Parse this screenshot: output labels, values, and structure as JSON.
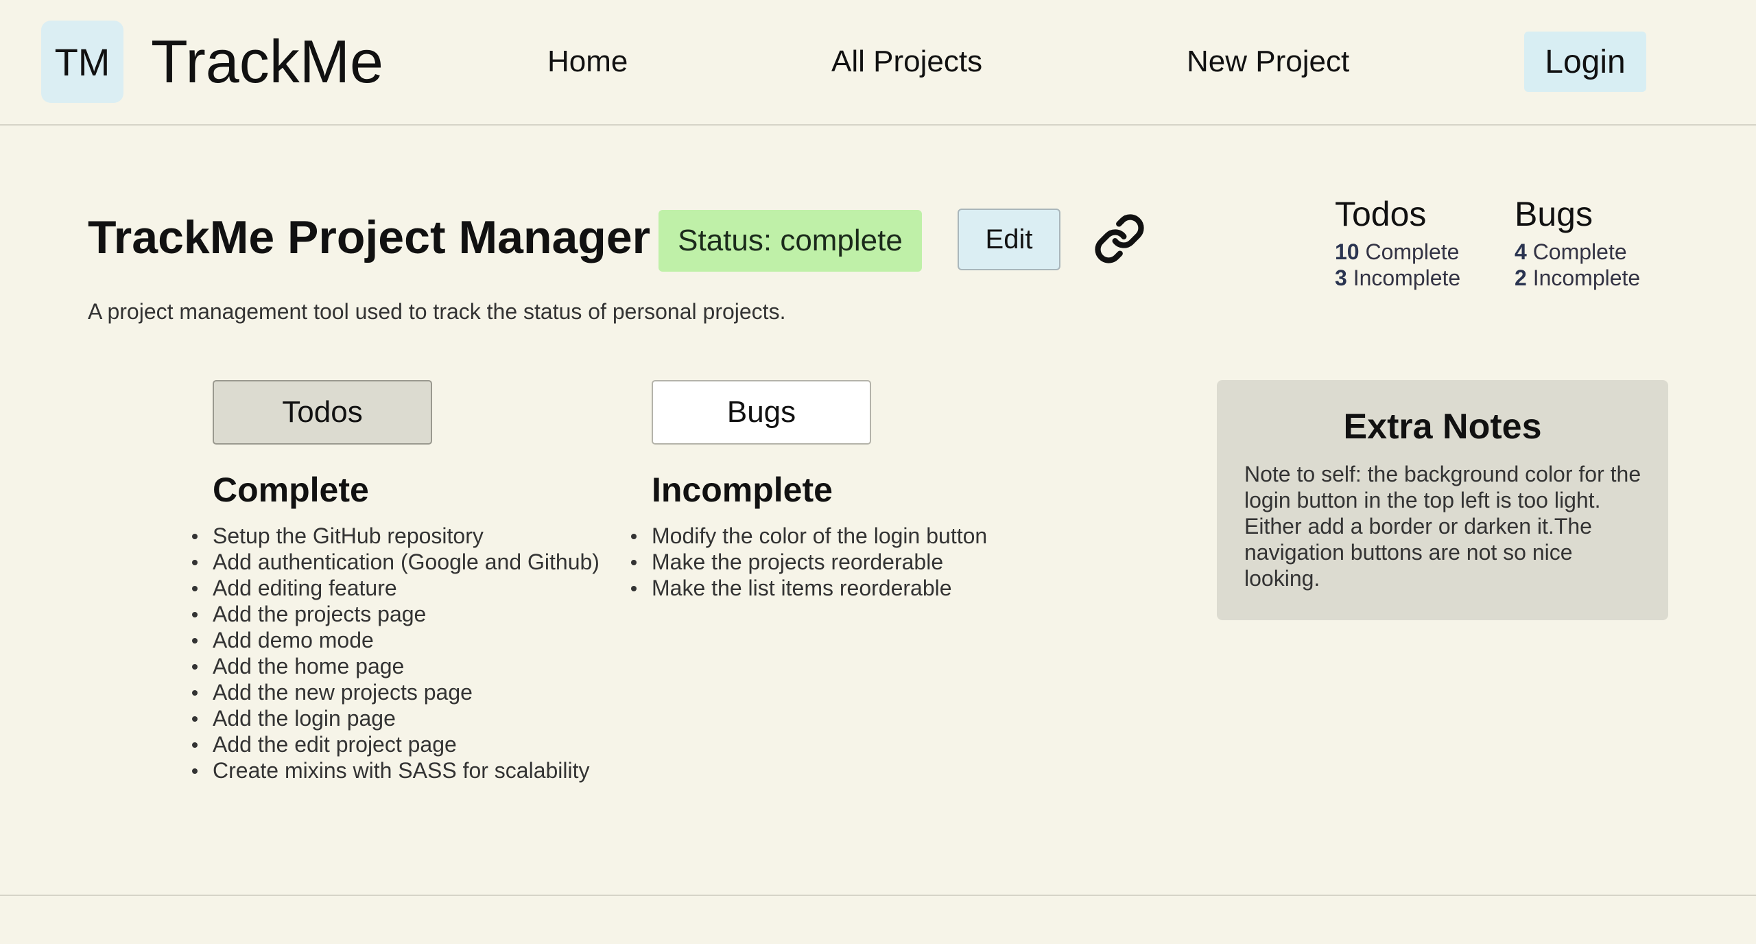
{
  "nav": {
    "logo_text": "TM",
    "brand": "TrackMe",
    "links": [
      "Home",
      "All Projects",
      "New Project"
    ],
    "login_label": "Login"
  },
  "project": {
    "title": "TrackMe Project Manager",
    "status": "Status: complete",
    "edit_label": "Edit",
    "link_icon": "link-icon",
    "description": "A project management tool used to track the status of personal projects."
  },
  "stats": {
    "todos": {
      "heading": "Todos",
      "complete_count": "10",
      "complete_label": "Complete",
      "incomplete_count": "3",
      "incomplete_label": "Incomplete"
    },
    "bugs": {
      "heading": "Bugs",
      "complete_count": "4",
      "complete_label": "Complete",
      "incomplete_count": "2",
      "incomplete_label": "Incomplete"
    }
  },
  "tabs": {
    "todos": "Todos",
    "bugs": "Bugs"
  },
  "complete": {
    "heading": "Complete",
    "items": [
      "Setup the GitHub repository",
      "Add authentication (Google and Github)",
      "Add editing feature",
      "Add the projects page",
      "Add demo mode",
      "Add the home page",
      "Add the new projects page",
      "Add the login page",
      "Add the edit project page",
      "Create mixins with SASS for scalability"
    ]
  },
  "incomplete": {
    "heading": "Incomplete",
    "items": [
      "Modify the color of the login button",
      "Make the projects reorderable",
      "Make the list items reorderable"
    ]
  },
  "notes": {
    "title": "Extra Notes",
    "body": "Note to self: the background color for the login button in the top left is too light. Either add a border or darken it.The navigation buttons are not so nice looking."
  },
  "colors": {
    "background": "#f6f4e8",
    "status_badge": "#bff0a8",
    "login_button": "#d8eef3",
    "notes_card": "#dcdbd0"
  }
}
